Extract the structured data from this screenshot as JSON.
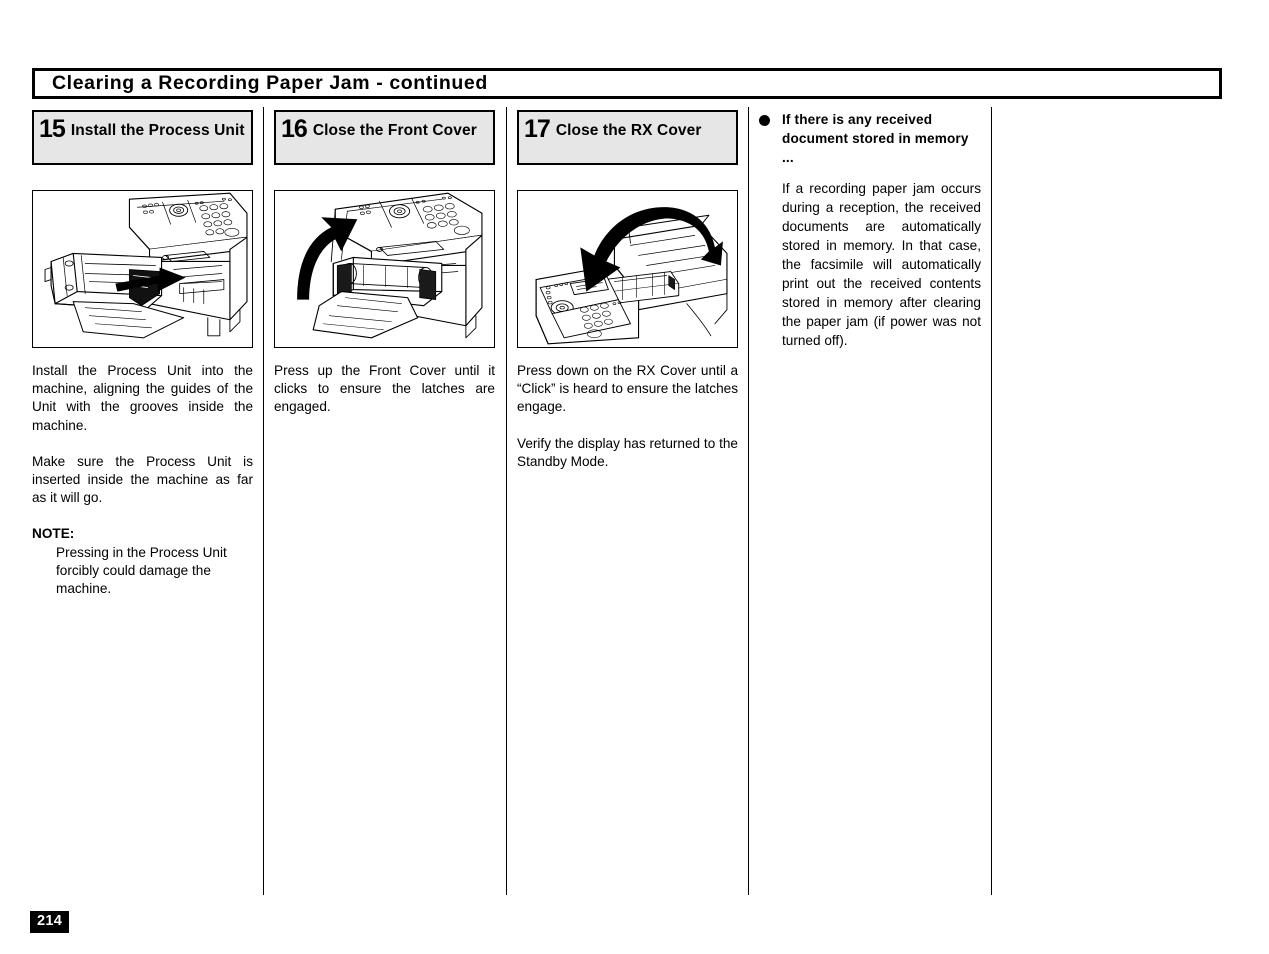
{
  "header": {
    "title": "Clearing a Recording Paper Jam - continued"
  },
  "steps": [
    {
      "number": "15",
      "label": "Install the Process Unit",
      "illustration_name": "process-unit-insertion-illustration",
      "paragraphs": [
        "Install the Process Unit into the machine, aligning the guides of the Unit with the grooves inside the machine.",
        "Make sure the Process Unit is inserted inside the machine as far as it will go."
      ],
      "note_label": "NOTE:",
      "note_text": "Pressing in the Process Unit forcibly could damage the machine."
    },
    {
      "number": "16",
      "label": "Close the Front Cover",
      "illustration_name": "front-cover-closing-illustration",
      "paragraphs": [
        "Press up the Front Cover until it clicks to ensure the latches are engaged."
      ]
    },
    {
      "number": "17",
      "label": "Close the RX Cover",
      "illustration_name": "rx-cover-closing-illustration",
      "paragraphs": [
        "Press down on the RX Cover until a “Click” is heard to ensure the latches engage.",
        "Verify the display has returned to the Standby Mode."
      ]
    }
  ],
  "sidenote": {
    "heading": "If there is any received document stored in memory  ...",
    "body": "If a recording paper jam occurs during a reception, the received documents are automatically stored in memory. In that case, the facsimile will automatically print out the received contents stored in memory after clearing the paper jam (if power was not turned off)."
  },
  "footer": {
    "page_number": "214"
  },
  "colors": {
    "step_box_fill": "#e6e6e6",
    "rule": "#000000",
    "page_badge_bg": "#000000",
    "page_badge_text": "#ffffff"
  }
}
